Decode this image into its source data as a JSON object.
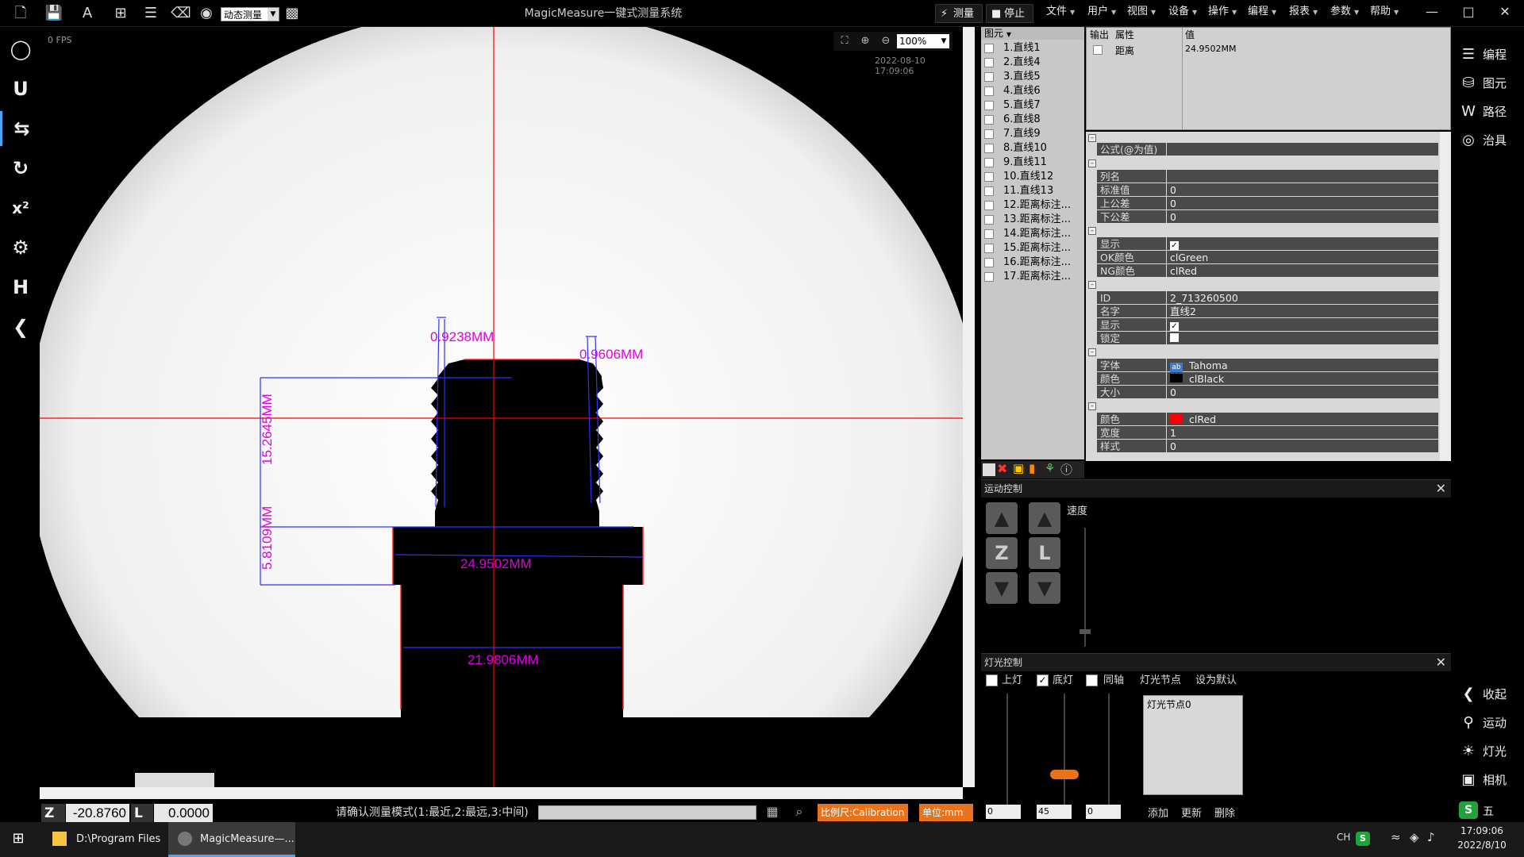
{
  "app": {
    "title": "MagicMeasure一键式测量系统",
    "mode": "动态测量",
    "measure_btn": "测量",
    "stop_btn": "停止"
  },
  "menu": [
    "文件",
    "用户",
    "视图",
    "设备",
    "操作",
    "编程",
    "报表",
    "参数",
    "帮助"
  ],
  "view": {
    "fps": "0 FPS",
    "zoom": "100%",
    "timestamp": "2022-08-10 17:09:06",
    "measurements": {
      "d1": "0.9238MM",
      "d2": "0.9606MM",
      "d3": "15.2645MM",
      "d4": "5.8109MM",
      "d5": "24.9502MM",
      "d6": "21.9806MM"
    }
  },
  "elements": {
    "header": "图元",
    "items": [
      "1.直线1",
      "2.直线4",
      "3.直线5",
      "4.直线6",
      "5.直线7",
      "6.直线8",
      "7.直线9",
      "8.直线10",
      "9.直线11",
      "10.直线12",
      "11.直线13",
      "12.距离标注...",
      "13.距离标注...",
      "14.距离标注...",
      "15.距离标注...",
      "16.距离标注...",
      "17.距离标注..."
    ]
  },
  "output": {
    "col_out": "输出",
    "col_prop": "属性",
    "col_val": "值",
    "row_prop": "距离",
    "row_val": "24.9502MM"
  },
  "props": {
    "formula": "公式(@为值)",
    "colname": "列名",
    "std": "标准值",
    "std_v": "0",
    "up": "上公差",
    "up_v": "0",
    "down": "下公差",
    "down_v": "0",
    "show": "显示",
    "okcolor": "OK颜色",
    "okcolor_v": "clGreen",
    "ngcolor": "NG颜色",
    "ngcolor_v": "clRed",
    "id": "ID",
    "id_v": "2_713260500",
    "name": "名字",
    "name_v": "直线2",
    "show2": "显示",
    "lock": "锁定",
    "font": "字体",
    "font_icon": "ab",
    "font_v": "Tahoma",
    "color": "颜色",
    "color_v": "clBlack",
    "size": "大小",
    "size_v": "0",
    "color2": "颜色",
    "color2_v": "clRed",
    "width": "宽度",
    "width_v": "1",
    "style": "样式",
    "style_v": "0"
  },
  "motion": {
    "title": "运动控制",
    "speed": "速度",
    "z": "Z",
    "l": "L"
  },
  "light": {
    "title": "灯光控制",
    "top": "上灯",
    "bottom": "底灯",
    "coax": "同轴",
    "nodes": "灯光节点",
    "default": "设为默认",
    "node0": "灯光节点0",
    "v1": "0",
    "v2": "45",
    "v3": "0",
    "add": "添加",
    "update": "更新",
    "delete": "删除"
  },
  "status": {
    "z_label": "Z",
    "z_value": "-20.8760",
    "l_label": "L",
    "l_value": "0.0000",
    "message": "请确认测量模式(1:最近,2:最远,3:中间)",
    "scale": "比例尺:Calibration",
    "unit": "单位:mm"
  },
  "rightnav": {
    "program": "编程",
    "element": "图元",
    "path": "路径",
    "fixture": "治具",
    "collapse": "收起",
    "motion": "运动",
    "light": "灯光",
    "camera": "相机"
  },
  "ime": {
    "wubi": "五"
  },
  "taskbar": {
    "app1": "D:\\Program Files ...",
    "app2": "MagicMeasure—...",
    "lang": "CH",
    "time": "17:09:06",
    "date": "2022/8/10"
  },
  "colors": {
    "accent": "#4aa3ff",
    "measure": "#e000e0",
    "orange": "#e8731a",
    "crosshair": "#ff0000"
  }
}
